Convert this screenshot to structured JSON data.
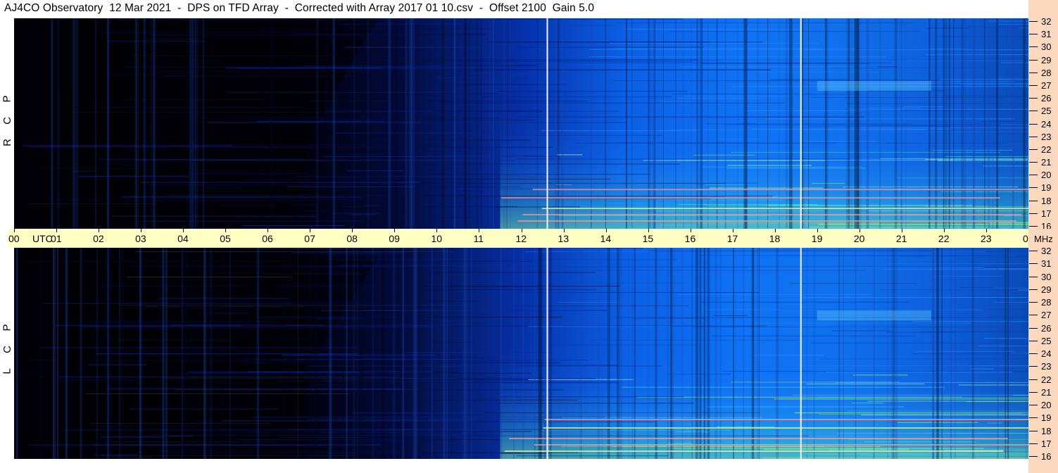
{
  "title": "AJ4CO Observatory  12 Mar 2021  -  DPS on TFD Array  -  Corrected with Array 2017 01 10.csv  -  Offset 2100  Gain 5.0",
  "chart_data": {
    "type": "heatmap",
    "title": "AJ4CO Observatory  12 Mar 2021  -  DPS on TFD Array  -  Corrected with Array 2017 01 10.csv  -  Offset 2100  Gain 5.0",
    "xlabel": "UTC",
    "ylabel": "MHz",
    "x_ticks": [
      "00",
      "01",
      "02",
      "03",
      "04",
      "05",
      "06",
      "07",
      "08",
      "09",
      "10",
      "11",
      "12",
      "13",
      "14",
      "15",
      "16",
      "17",
      "18",
      "19",
      "20",
      "21",
      "22",
      "23",
      "00"
    ],
    "y_ticks": [
      "32",
      "31",
      "30",
      "29",
      "28",
      "27",
      "26",
      "25",
      "24",
      "23",
      "22",
      "21",
      "20",
      "19",
      "18",
      "17",
      "16"
    ],
    "xlim": [
      0,
      24
    ],
    "ylim": [
      16,
      32
    ],
    "markers_utc": [
      12.6,
      18.6
    ],
    "panels": [
      {
        "name": "RCP",
        "letters": [
          "R",
          "C",
          "P"
        ]
      },
      {
        "name": "LCP",
        "letters": [
          "L",
          "C",
          "P"
        ]
      }
    ]
  }
}
